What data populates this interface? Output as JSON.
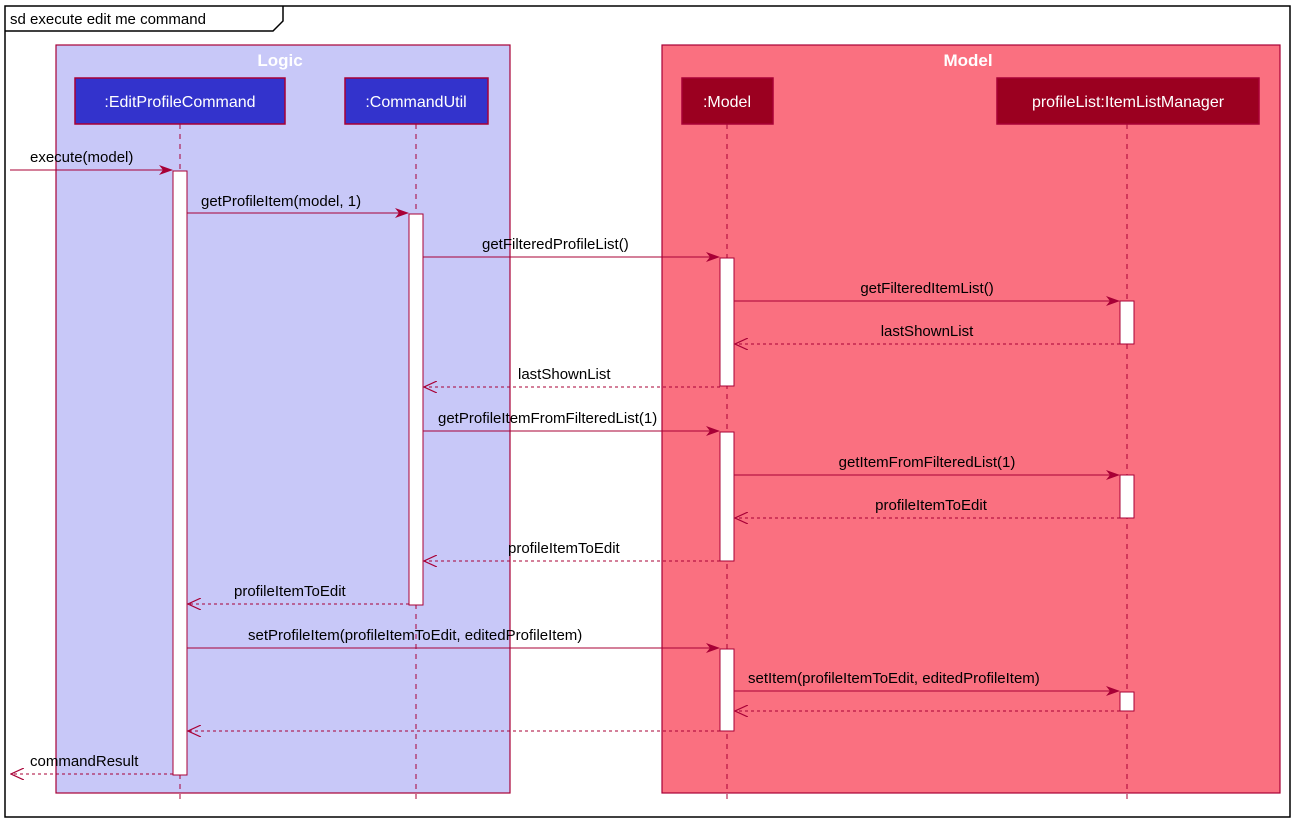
{
  "frame": {
    "title": "sd execute edit me command"
  },
  "boxes": [
    {
      "title": "Logic",
      "fill": "#C8C8F8",
      "stroke": "#A80036"
    },
    {
      "title": "Model",
      "fill": "#FA7080",
      "stroke": "#A80036"
    }
  ],
  "participants": [
    {
      "label": ":EditProfileCommand",
      "fill": "#3333CC"
    },
    {
      "label": ":CommandUtil",
      "fill": "#3333CC"
    },
    {
      "label": ":Model",
      "fill": "#9B0020"
    },
    {
      "label": "profileList:ItemListManager",
      "fill": "#9B0020"
    }
  ],
  "messages": [
    {
      "label": "execute(model)",
      "kind": "call"
    },
    {
      "label": "getProfileItem(model, 1)",
      "kind": "call"
    },
    {
      "label": "getFilteredProfileList()",
      "kind": "call"
    },
    {
      "label": "getFilteredItemList()",
      "kind": "call"
    },
    {
      "label": "lastShownList",
      "kind": "return"
    },
    {
      "label": "lastShownList",
      "kind": "return"
    },
    {
      "label": "getProfileItemFromFilteredList(1)",
      "kind": "call"
    },
    {
      "label": "getItemFromFilteredList(1)",
      "kind": "call"
    },
    {
      "label": "profileItemToEdit",
      "kind": "return"
    },
    {
      "label": "profileItemToEdit",
      "kind": "return"
    },
    {
      "label": "profileItemToEdit",
      "kind": "return"
    },
    {
      "label": "setProfileItem(profileItemToEdit, editedProfileItem)",
      "kind": "call"
    },
    {
      "label": "setItem(profileItemToEdit, editedProfileItem)",
      "kind": "call"
    },
    {
      "label": "",
      "kind": "return"
    },
    {
      "label": "",
      "kind": "return"
    },
    {
      "label": "commandResult",
      "kind": "return"
    }
  ],
  "colors": {
    "line": "#A80036",
    "activation": "#ffffff"
  }
}
